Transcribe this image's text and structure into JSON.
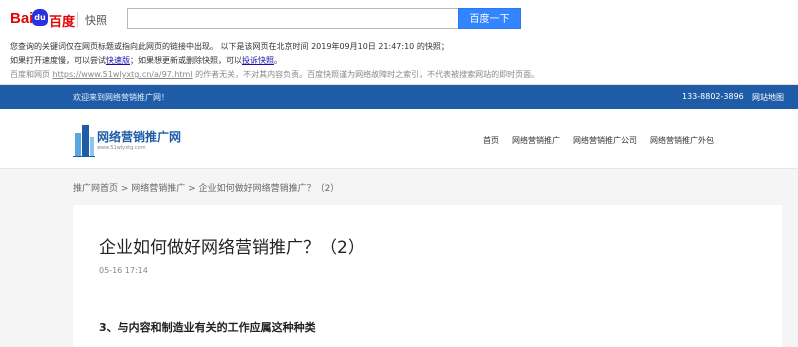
{
  "snapshot": {
    "logo_latin": "Bai",
    "logo_paw": "du",
    "logo_cn": "百度",
    "label": "快照",
    "search_value": "",
    "button": "百度一下",
    "line1": "您查询的关键词仅在网页标题或指向此网页的链接中出现。   以下是该网页在北京时间 2019年09月10日 21:47:10 的快照；",
    "line2_prefix": "如果打开速度慢，可以尝试",
    "line2_link1": "快速版",
    "line2_mid": "；如果想更新或删除快照，可以",
    "line2_link2": "投诉快照",
    "line2_suffix": "。",
    "line3_prefix": "百度和网页 ",
    "line3_url": "https://www.51wlyxtg.cn/a/97.html",
    "line3_suffix": " 的作者无关，不对其内容负责。百度快照谨为网络故障时之索引，不代表被搜索网站的即时页面。"
  },
  "topbar": {
    "welcome": "欢迎来到网络营销推广网！",
    "phone": "133-8802-3896",
    "sitemap": "网站地图"
  },
  "site": {
    "logo_name": "网络营销推广网",
    "logo_url": "www.51wlyxtg.com",
    "menu": [
      "首页",
      "网络营销推广",
      "网络营销推广公司",
      "网络营销推广外包"
    ]
  },
  "breadcrumb": {
    "home": "推广网首页",
    "sep1": " > ",
    "cat": "网络营销推广",
    "sep2": " > ",
    "current": "企业如何做好网络营销推广？（2）"
  },
  "article": {
    "title": "企业如何做好网络营销推广？（2）",
    "date": "05-16 17:14",
    "heading": "3、与内容和制造业有关的工作应属这种种类"
  },
  "colors": {
    "bar_blue": "#1f5ca8",
    "button_blue": "#3385ff",
    "baidu_red": "#e10602"
  }
}
